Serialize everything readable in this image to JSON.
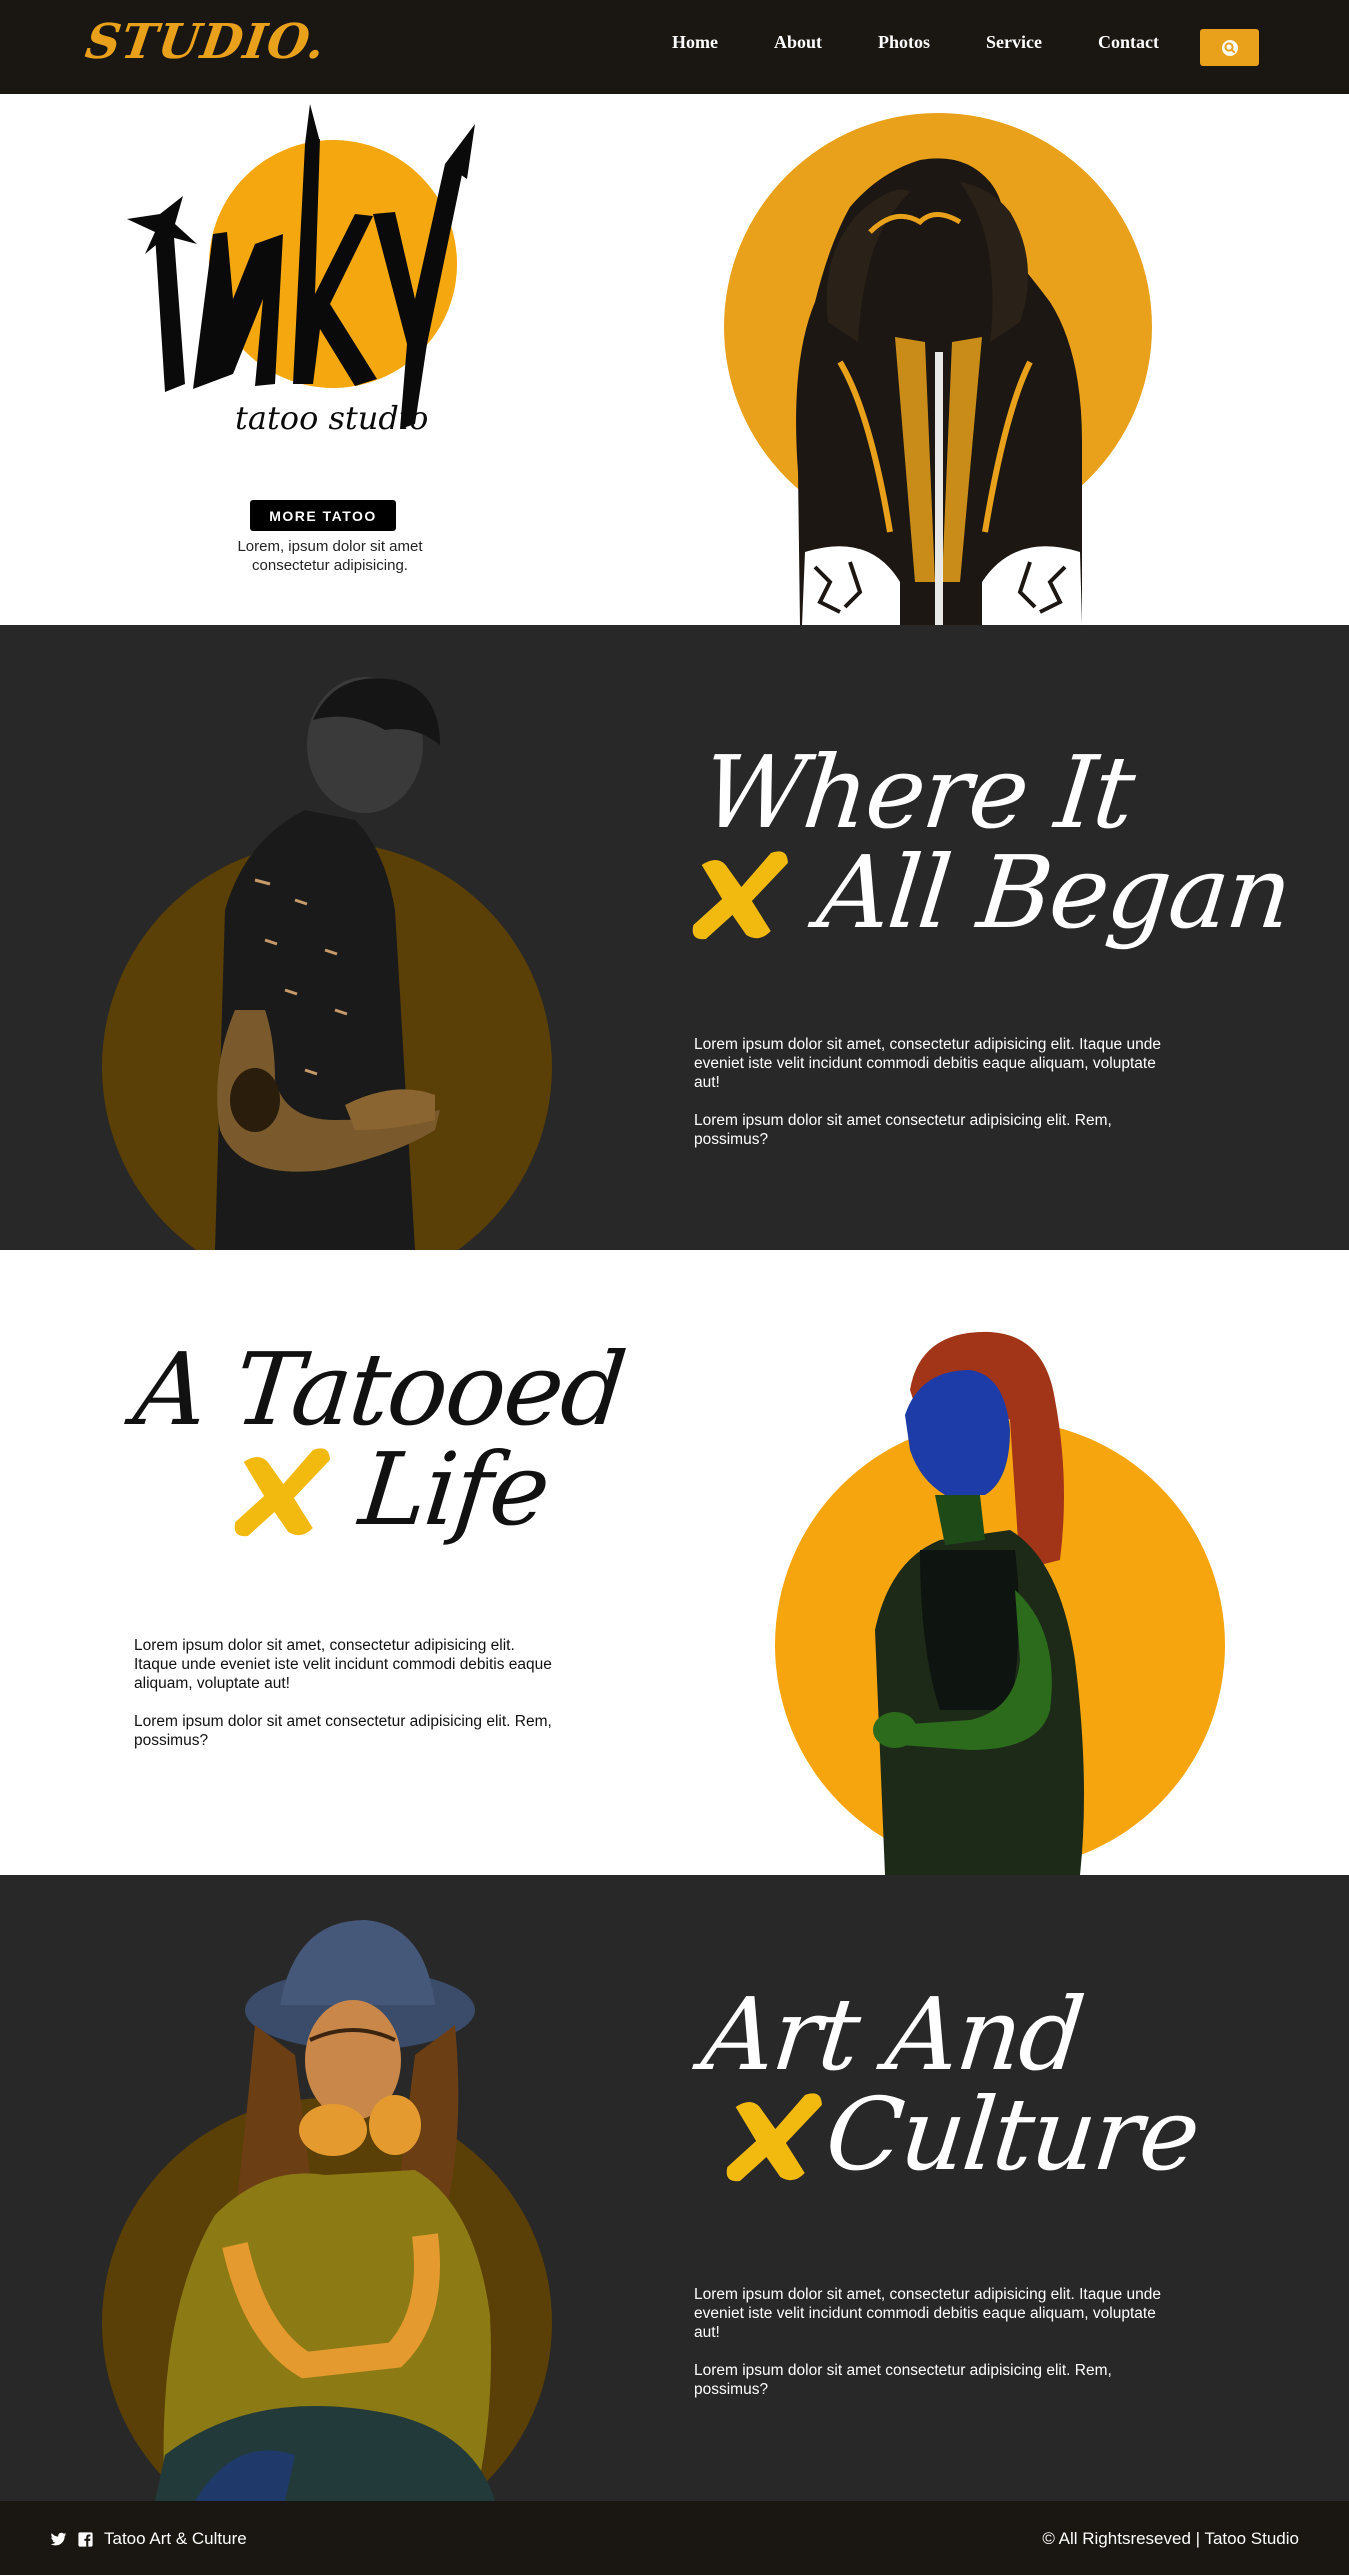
{
  "brand": {
    "logo_text": "STUDIO.",
    "accent_color": "#e9a11b",
    "dark_color": "#282828"
  },
  "nav": {
    "items": [
      {
        "label": "Home"
      },
      {
        "label": "About"
      },
      {
        "label": "Photos"
      },
      {
        "label": "Service"
      },
      {
        "label": "Contact"
      }
    ],
    "search_icon": "search-icon"
  },
  "hero": {
    "wordmark": "inky",
    "wordmark_sub": "tatoo studio",
    "button_label": "MORE TATOO",
    "description": "Lorem, ipsum dolor sit amet consectetur adipisicing."
  },
  "sections": [
    {
      "title_line1": "Where It",
      "title_line2": "All Began",
      "paragraph1": "Lorem ipsum dolor sit amet, consectetur adipisicing elit. Itaque unde eveniet iste velit incidunt commodi debitis eaque aliquam, voluptate aut!",
      "paragraph2": "Lorem ipsum dolor sit amet consectetur adipisicing elit. Rem, possimus?"
    },
    {
      "title_line1": "A Tatooed",
      "title_line2": "Life",
      "paragraph1": "Lorem ipsum dolor sit amet, consectetur adipisicing elit. Itaque unde eveniet iste velit incidunt commodi debitis eaque aliquam, voluptate aut!",
      "paragraph2": "Lorem ipsum dolor sit amet consectetur adipisicing elit. Rem, possimus?"
    },
    {
      "title_line1": "Art And",
      "title_line2": "Culture",
      "paragraph1": "Lorem ipsum dolor sit amet, consectetur adipisicing elit. Itaque unde eveniet iste velit incidunt commodi debitis eaque aliquam, voluptate aut!",
      "paragraph2": "Lorem ipsum dolor sit amet consectetur adipisicing elit. Rem, possimus?"
    }
  ],
  "footer": {
    "left_text": "Tatoo Art & Culture",
    "right_text": "© All Rightsreseved | Tatoo Studio",
    "icons": [
      "twitter-icon",
      "facebook-icon"
    ]
  }
}
